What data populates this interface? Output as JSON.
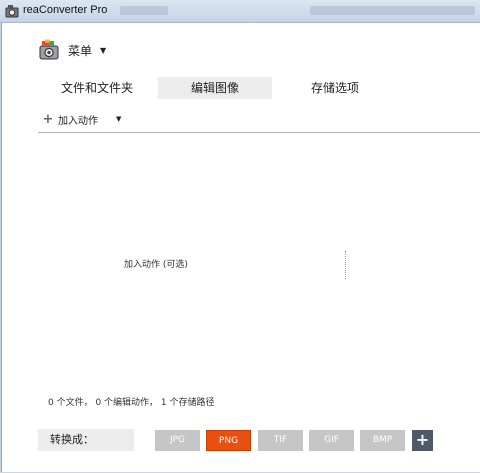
{
  "titlebar": {
    "title": "reaConverter Pro"
  },
  "menu": {
    "label": "菜单"
  },
  "tabs": [
    {
      "label": "文件和文件夹",
      "active": false
    },
    {
      "label": "编辑图像",
      "active": true
    },
    {
      "label": "存储选项",
      "active": false
    }
  ],
  "toolbar": {
    "add_action_label": "加入动作"
  },
  "canvas": {
    "hint": "加入动作 (可选)"
  },
  "status": {
    "text": "0 个文件， 0 个编辑动作， 1 个存储路径"
  },
  "convert": {
    "label": "转换成：",
    "formats": [
      "JPG",
      "PNG",
      "TIF",
      "GIF",
      "BMP"
    ],
    "selected": "PNG"
  },
  "colors": {
    "accent": "#e8500f",
    "inactive_format": "#c6c6c6",
    "add_button": "#505a66"
  }
}
